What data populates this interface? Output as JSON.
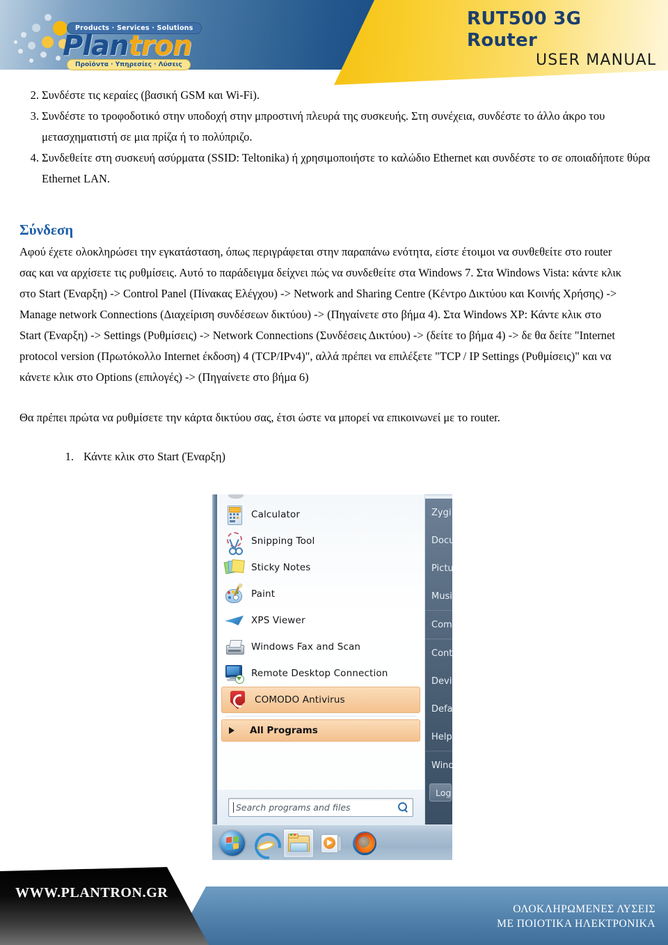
{
  "header": {
    "product_title_line1": "RUT500 3G",
    "product_title_line2": "Router",
    "doc_type": "USER MANUAL",
    "logo": {
      "tagline_en": "Products · Services · Solutions",
      "brand_part1": "Plan",
      "brand_part2": "tron",
      "tagline_el": "Προϊόντα · Υπηρεσίες · Λύσεις"
    },
    "colors": {
      "blue": "#1c4f8f",
      "yellow": "#f5c213",
      "navy": "#11417a"
    }
  },
  "steps": [
    {
      "num": "2.",
      "text": "Συνδέστε τις κεραίες (βασική GSM και Wi-Fi)."
    },
    {
      "num": "3.",
      "text": "Συνδέστε το τροφοδοτικό στην υποδοχή στην μπροστινή πλευρά της συσκευής. Στη συνέχεια, συνδέστε το άλλο άκρο του μετασχηματιστή σε μια πρίζα ή το πολύπριζο."
    },
    {
      "num": "4.",
      "text": "Συνδεθείτε στη συσκευή ασύρματα (SSID: Teltonika) ή χρησιμοποιήστε το καλώδιο Ethernet και συνδέστε το σε οποιαδήποτε θύρα Ethernet LAN."
    }
  ],
  "section": {
    "title": "Σύνδεση",
    "paragraph1": "Αφού έχετε ολοκληρώσει την εγκατάσταση, όπως περιγράφεται στην παραπάνω ενότητα, είστε έτοιμοι να συνθεθείτε στο router σας και να αρχίσετε τις ρυθμίσεις. Αυτό το παράδειγμα δείχνει πώς να συνδεθείτε στα Windows 7. Στα Windows Vista: κάντε κλικ στο Start (Έναρξη) -> Control Panel (Πίνακας Ελέγχου) -> Network and Sharing Centre (Κέντρο Δικτύου και Κοινής Χρήσης) -> Manage network Connections (Διαχείριση συνδέσεων δικτύου) -> (Πηγαίνετε στο βήμα 4). Στα Windows XP: Κάντε κλικ στο Start (Έναρξη) -> Settings (Ρυθμίσεις) -> Network Connections (Συνδέσεις Δικτύου) -> (δείτε το βήμα 4) -> δε θα δείτε \"Internet protocol version (Πρωτόκολλο Internet έκδοση) 4 (TCP/IPv4)\", αλλά πρέπει να επιλέξετε \"TCP / IP Settings (Ρυθμίσεις)\" και να κάνετε κλικ στο Options (επιλογές) -> (Πηγαίνετε στο βήμα 6)",
    "paragraph2": "Θα πρέπει πρώτα να ρυθμίσετε την κάρτα δικτύου σας, έτσι ώστε να μπορεί να επικοινωνεί με το router.",
    "substeps": [
      {
        "num": "1.",
        "text": "Κάντε κλικ στο Start (Έναρξη)"
      }
    ]
  },
  "screenshot": {
    "left_items": [
      {
        "label": "Calculator",
        "icon": "calculator-icon",
        "selected": false
      },
      {
        "label": "Snipping Tool",
        "icon": "scissors-icon",
        "selected": false
      },
      {
        "label": "Sticky Notes",
        "icon": "sticky-notes-icon",
        "selected": false
      },
      {
        "label": "Paint",
        "icon": "paint-palette-icon",
        "selected": false
      },
      {
        "label": "XPS Viewer",
        "icon": "xps-viewer-icon",
        "selected": false
      },
      {
        "label": "Windows Fax and Scan",
        "icon": "fax-scan-icon",
        "selected": false
      },
      {
        "label": "Remote Desktop Connection",
        "icon": "remote-desktop-icon",
        "selected": false
      },
      {
        "label": "COMODO Antivirus",
        "icon": "comodo-shield-icon",
        "selected": true
      }
    ],
    "all_programs_label": "All Programs",
    "search_placeholder": "Search programs and files",
    "right_items": [
      "Zygi",
      "Docu",
      "Pictu",
      "Musi",
      "Com",
      "Cont",
      "Devi",
      "Defa",
      "Help",
      "Wind"
    ],
    "logoff_label": "Log",
    "taskbar_icons": [
      "start-orb-icon",
      "internet-explorer-icon",
      "windows-explorer-icon",
      "windows-media-player-icon",
      "firefox-icon"
    ]
  },
  "footer": {
    "url": "WWW.PLANTRON.GR",
    "slogan_line1": "ΟΛΟΚΛΗΡΩΜΕΝΕΣ ΛΥΣΕΙΣ",
    "slogan_line2": "ΜΕ ΠΟΙΟΤΙΚΑ ΗΛΕΚΤΡΟΝΙΚΑ"
  }
}
